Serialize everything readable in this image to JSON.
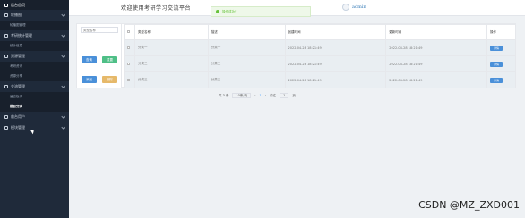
{
  "sidebar": {
    "brand": "后台首页",
    "groups": [
      {
        "label": "轮播图",
        "items": [
          "轮播图管理"
        ]
      },
      {
        "label": "考研统计管理",
        "items": [
          "统计信息"
        ]
      },
      {
        "label": "资源管理",
        "items": [
          "考研资讯",
          "资源分享"
        ]
      },
      {
        "label": "交流管理",
        "items": [
          "留言板块",
          "题目分类"
        ],
        "active": "题目分类"
      },
      {
        "label": "前台用户",
        "items": []
      },
      {
        "label": "模块管理",
        "items": []
      }
    ]
  },
  "topbar": {
    "welcome": "欢迎使用考研学习交流平台",
    "toast": "操作成功！",
    "user": "admin"
  },
  "filter": {
    "placeholder": "类型名称",
    "query_label": "查询",
    "reset_label": "重置",
    "add_label": "添加",
    "delete_label": "删除"
  },
  "table": {
    "headers": [
      "类型名称",
      "描述",
      "创建时间",
      "更新时间",
      "操作"
    ],
    "rows": [
      [
        "分类一",
        "分类一",
        "2022-04-28 18:21:49",
        "2022-04-28 18:21:49",
        "详情"
      ],
      [
        "分类二",
        "分类二",
        "2022-04-28 18:21:49",
        "2022-04-28 18:21:49",
        "详情"
      ],
      [
        "分类三",
        "分类三",
        "2022-04-28 18:21:49",
        "2022-04-28 18:21:49",
        "详情"
      ]
    ]
  },
  "pager": {
    "total": "共 3 条",
    "page_size": "10条/页",
    "current_page": "1",
    "goto_label": "前往",
    "goto_value": "1",
    "page_suffix": "页"
  },
  "watermark": "CSDN @MZ_ZXD001"
}
